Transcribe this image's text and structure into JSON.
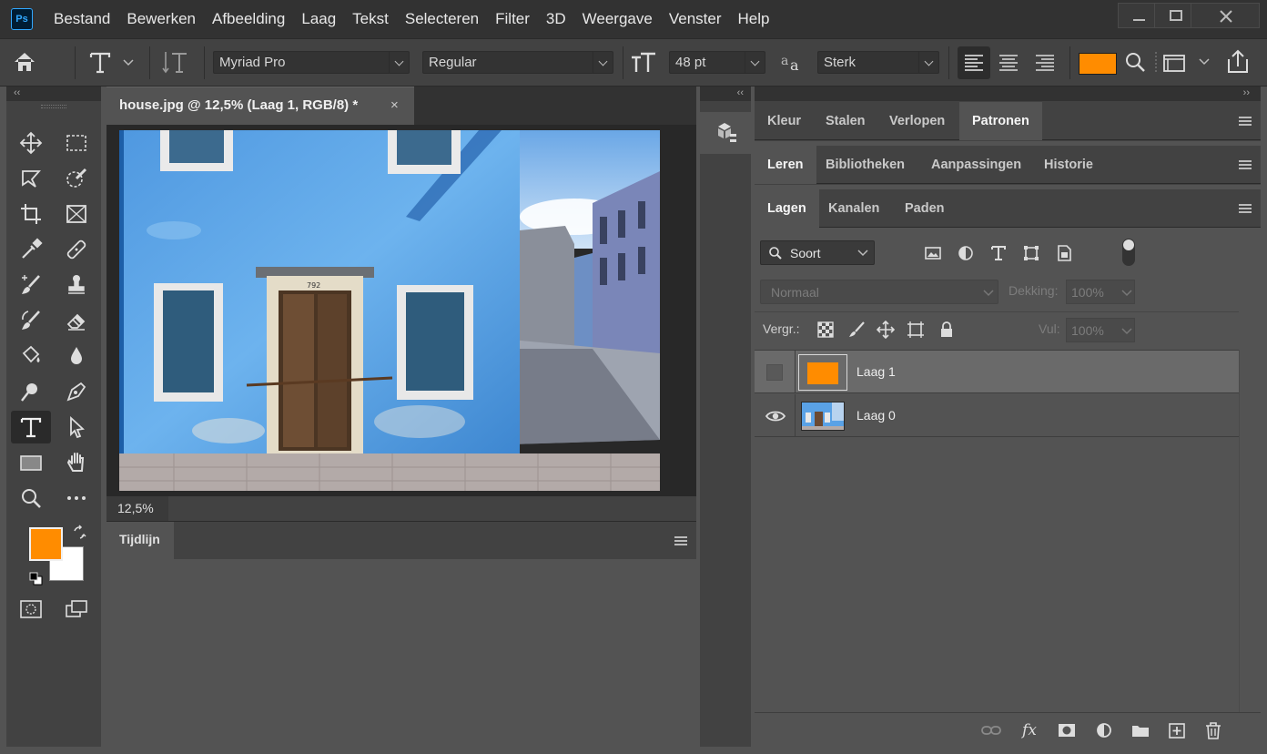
{
  "app": {
    "logo_text": "Ps"
  },
  "menu": [
    "Bestand",
    "Bewerken",
    "Afbeelding",
    "Laag",
    "Tekst",
    "Selecteren",
    "Filter",
    "3D",
    "Weergave",
    "Venster",
    "Help"
  ],
  "options": {
    "font_family": "Myriad Pro",
    "font_style": "Regular",
    "font_size": "48 pt",
    "anti_alias": "Sterk",
    "text_color": "#ff8c00"
  },
  "toolbar": {
    "collapse": "‹‹",
    "foreground_color": "#ff8c00",
    "background_color": "#ffffff"
  },
  "document": {
    "tab_title": "house.jpg @ 12,5% (Laag 1, RGB/8) *",
    "close": "×",
    "zoom": "12,5%",
    "door_number": "792"
  },
  "timeline": {
    "tab": "Tijdlijn"
  },
  "panels": {
    "group1": [
      "Kleur",
      "Stalen",
      "Verlopen",
      "Patronen"
    ],
    "group2": [
      "Leren",
      "Bibliotheken",
      "Aanpassingen",
      "Historie"
    ],
    "group3": [
      "Lagen",
      "Kanalen",
      "Paden"
    ]
  },
  "layers": {
    "filter_kind": "Soort",
    "blend_mode": "Normaal",
    "opacity_label": "Dekking:",
    "opacity_value": "100%",
    "lock_label": "Vergr.:",
    "fill_label": "Vul:",
    "fill_value": "100%",
    "items": [
      {
        "name": "Laag 1",
        "visible": false,
        "selected": true
      },
      {
        "name": "Laag 0",
        "visible": true,
        "selected": false
      }
    ],
    "fx_label": "fx"
  }
}
